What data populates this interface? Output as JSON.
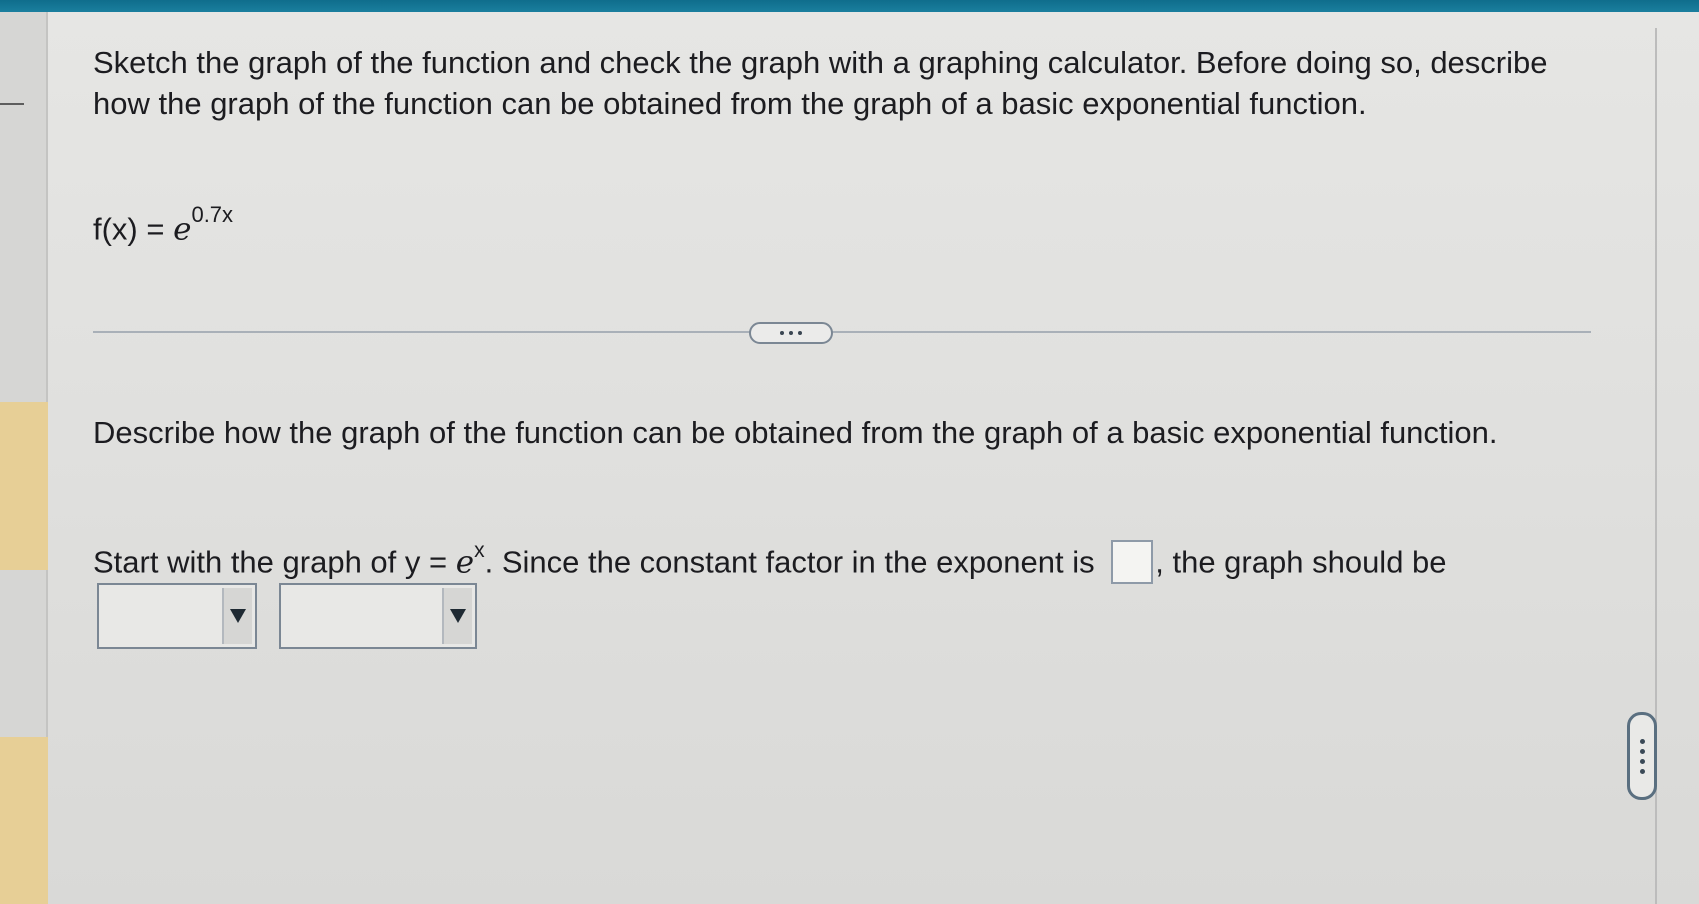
{
  "question": {
    "text": "Sketch the graph of the function and check the graph with a graphing calculator. Before doing so, describe how the graph of the function can be obtained from the graph of a basic exponential function."
  },
  "function": {
    "lhs": "f(x) = ",
    "base": "e",
    "exponent": "0.7x"
  },
  "more_button": {
    "icon": "ellipsis-icon"
  },
  "part": {
    "prompt": "Describe how the graph of the function can be obtained from the graph of a basic exponential function.",
    "sentence_start": "Start with the graph of y = ",
    "sentence_base": "e",
    "sentence_exponent": "x",
    "sentence_middle": ". Since the constant factor in the exponent is ",
    "sentence_end": ", the graph should be",
    "answer_value": "",
    "select1_value": "",
    "select2_value": ""
  },
  "colors": {
    "accent": "#0f6d8c",
    "highlight": "#e7cf96"
  }
}
